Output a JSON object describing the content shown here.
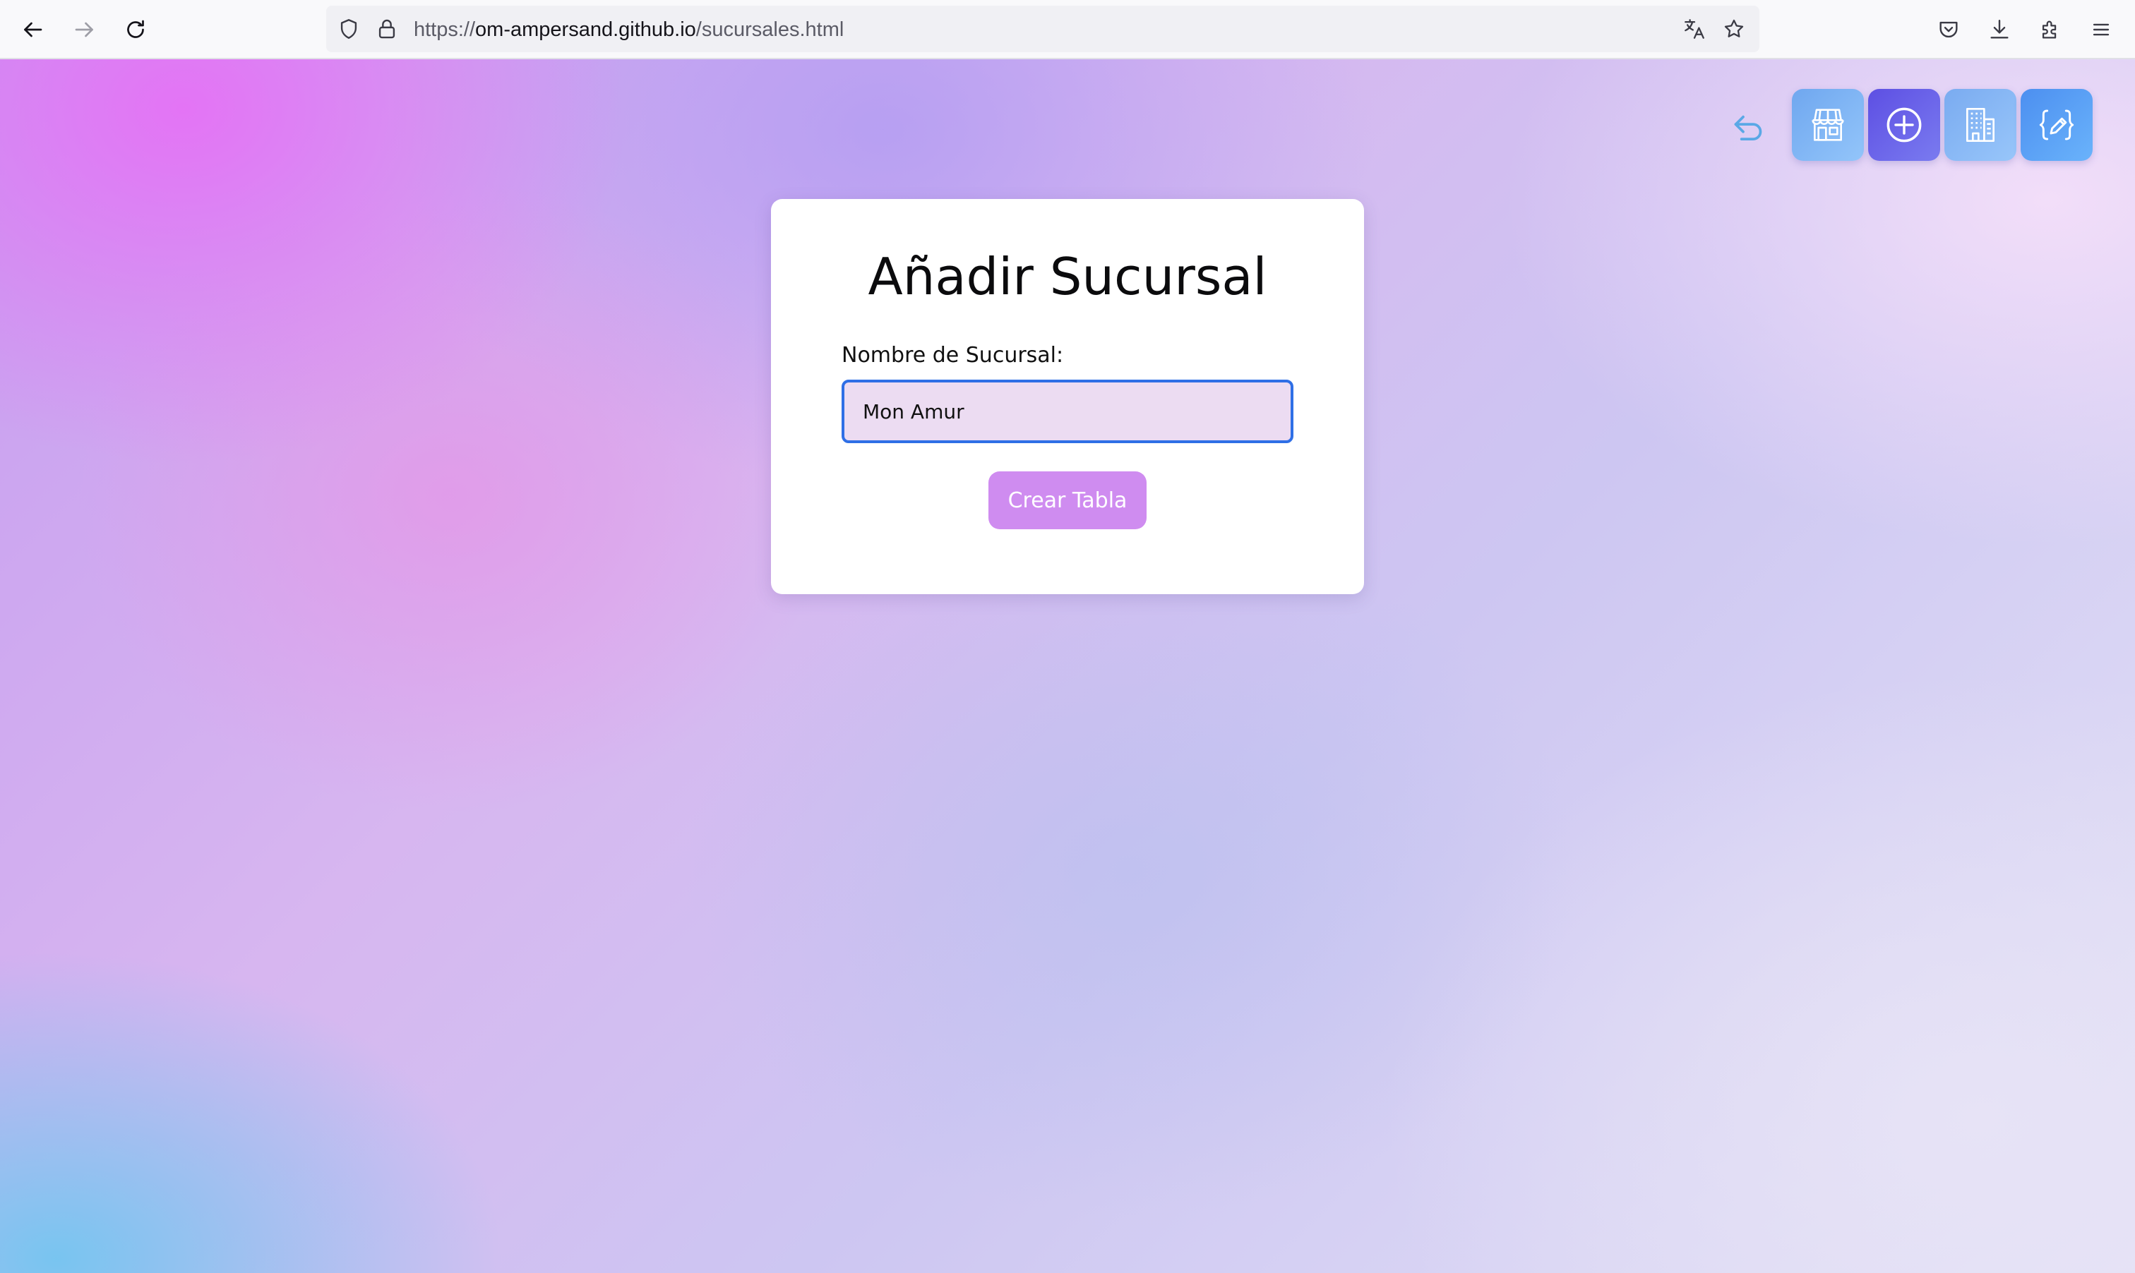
{
  "browser": {
    "url_scheme": "https://",
    "url_host": "om-ampersand.github.io",
    "url_path": "/sucursales.html",
    "icons": {
      "back": "back-arrow-icon",
      "forward": "forward-arrow-icon",
      "reload": "reload-icon",
      "shield": "shield-icon",
      "lock": "lock-icon",
      "translate": "translate-icon",
      "bookmark": "star-icon",
      "pocket": "pocket-icon",
      "downloads": "download-icon",
      "extensions": "puzzle-icon",
      "menu": "hamburger-menu-icon"
    }
  },
  "page": {
    "nav_icons": [
      "undo-icon",
      "store-icon",
      "add-circle-icon",
      "building-icon",
      "code-edit-icon"
    ],
    "form": {
      "title": "Añadir Sucursal",
      "label": "Nombre de Sucursal:",
      "input_value": "Mon Amur",
      "button_label": "Crear Tabla"
    },
    "colors": {
      "card_bg": "#ffffff",
      "input_bg": "#ecdcf2",
      "input_border": "#2f6fe6",
      "button_bg": "#cf8cf0",
      "accent_blue": "#4c8ff0",
      "accent_indigo": "#5d4fe3"
    }
  }
}
